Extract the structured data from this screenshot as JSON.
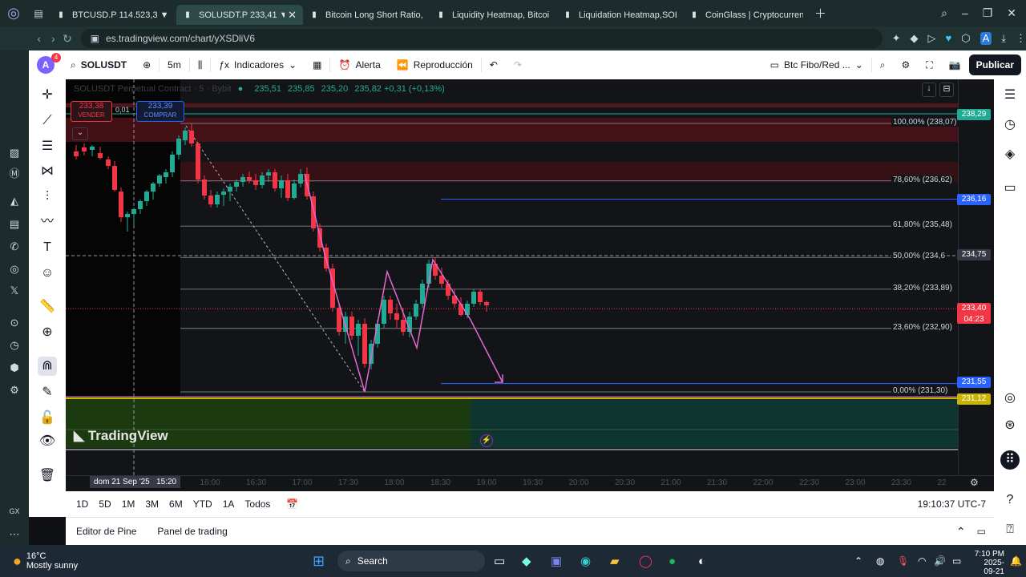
{
  "browser": {
    "tabs": [
      {
        "label": "BTCUSD.P 114.523,3 ▼ -",
        "active": false
      },
      {
        "label": "SOLUSDT.P 233,41 ▼",
        "active": true
      },
      {
        "label": "Bitcoin Long Short Ratio,",
        "active": false
      },
      {
        "label": "Liquidity Heatmap, Bitcoi",
        "active": false
      },
      {
        "label": "Liquidation Heatmap,SOL",
        "active": false
      },
      {
        "label": "CoinGlass | Cryptocurrenc",
        "active": false
      }
    ],
    "url": "es.tradingview.com/chart/yXSDliV6"
  },
  "header": {
    "notifications": "4",
    "avatar_letter": "A",
    "symbol": "SOLUSDT",
    "interval": "5m",
    "indicators": "Indicadores",
    "alert": "Alerta",
    "replay": "Reproducción",
    "layout_name": "Btc Fibo/Red ...",
    "publish": "Publicar"
  },
  "legend": {
    "title": "SOLUSDT Perpetual Contract · 5 · Bybit",
    "values": [
      "235,51",
      "235,85",
      "235,20",
      "235,82 +0,31 (+0,13%)"
    ],
    "sell_price": "233,38",
    "sell_label": "VENDER",
    "spread": "0,01",
    "buy_price": "233,39",
    "buy_label": "COMPRAR"
  },
  "fib_levels": [
    {
      "label": "100,00% (238,07)",
      "price": 238.07
    },
    {
      "label": "78,60% (236,62)",
      "price": 236.62
    },
    {
      "label": "61,80% (235,48)",
      "price": 235.48
    },
    {
      "label": "50,00% (234,6",
      "price": 234.69
    },
    {
      "label": "38,20% (233,89)",
      "price": 233.89
    },
    {
      "label": "23,60% (232,90)",
      "price": 232.9
    },
    {
      "label": "0,00% (231,30)",
      "price": 231.3
    }
  ],
  "price_tags": [
    {
      "label": "238,29",
      "color": "#22ab94",
      "price": 238.29
    },
    {
      "label": "236,16",
      "color": "#2962ff",
      "price": 236.16
    },
    {
      "label": "234,75",
      "color": "#363a45",
      "price": 234.75
    },
    {
      "label": "233,40",
      "sub": "04:23",
      "color": "#f23645",
      "price": 233.4
    },
    {
      "label": "231,55",
      "color": "#2962ff",
      "price": 231.55
    },
    {
      "label": "231,12",
      "color": "#c9b400",
      "price": 231.12
    }
  ],
  "time_axis": {
    "labels": [
      "15:20",
      "16:00",
      "16:30",
      "17:00",
      "17:30",
      "18:00",
      "18:30",
      "19:00",
      "19:30",
      "20:00",
      "20:30",
      "21:00",
      "21:30",
      "22:00",
      "22:30",
      "23:00",
      "23:30",
      "22"
    ],
    "crosshair_date": "dom 21 Sep '25",
    "crosshair_time": "15:20"
  },
  "watermark": "TradingView",
  "ranges": [
    "1D",
    "5D",
    "1M",
    "3M",
    "6M",
    "YTD",
    "1A",
    "Todos"
  ],
  "clock": "19:10:37 UTC-7",
  "panel_tabs": [
    "Editor de Pine",
    "Panel de trading"
  ],
  "taskbar": {
    "weather_temp": "16°C",
    "weather_desc": "Mostly sunny",
    "search": "Search",
    "time": "7:10 PM",
    "date": "2025-09-21"
  },
  "colors": {
    "up": "#22ab94",
    "down": "#f23645",
    "accent": "#2962ff"
  }
}
